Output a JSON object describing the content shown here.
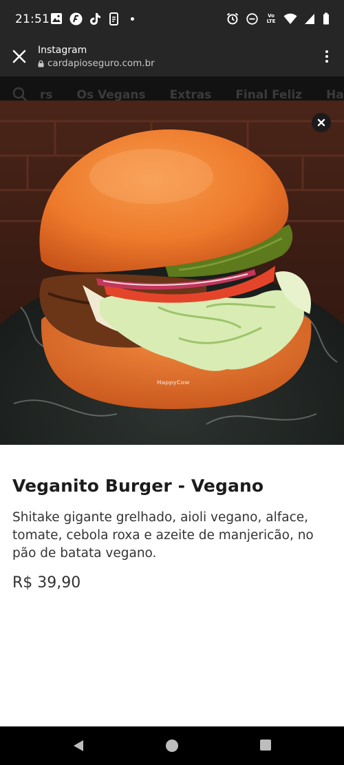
{
  "status_bar": {
    "time": "21:51",
    "left_icons": [
      "gallery-icon",
      "fx-icon",
      "tiktok-icon",
      "phone-link-icon",
      "notification-dot"
    ],
    "right_icons": [
      "alarm-icon",
      "dnd-icon",
      "volte-icon",
      "wifi-icon",
      "signal-icon",
      "battery-icon"
    ],
    "volte_text": "Vo LTE"
  },
  "browser": {
    "title": "Instagram",
    "url": "cardapioseguro.com.br"
  },
  "site_nav": {
    "items": [
      "rs",
      "Os Vegans",
      "Extras",
      "Final Feliz",
      "Hap"
    ]
  },
  "product": {
    "image_watermark": "HappyCow",
    "title": "Veganito Burger - Vegano",
    "description": "Shitake gigante grelhado, aioli vegano, alface, tomate, cebola roxa e azeite de manjericão, no pão de batata vegano.",
    "price": "R$ 39,90"
  },
  "colors": {
    "status_bg": "#262626",
    "nav_bg": "#121212",
    "bun": "#f07a2e",
    "content_bg": "#ffffff"
  }
}
